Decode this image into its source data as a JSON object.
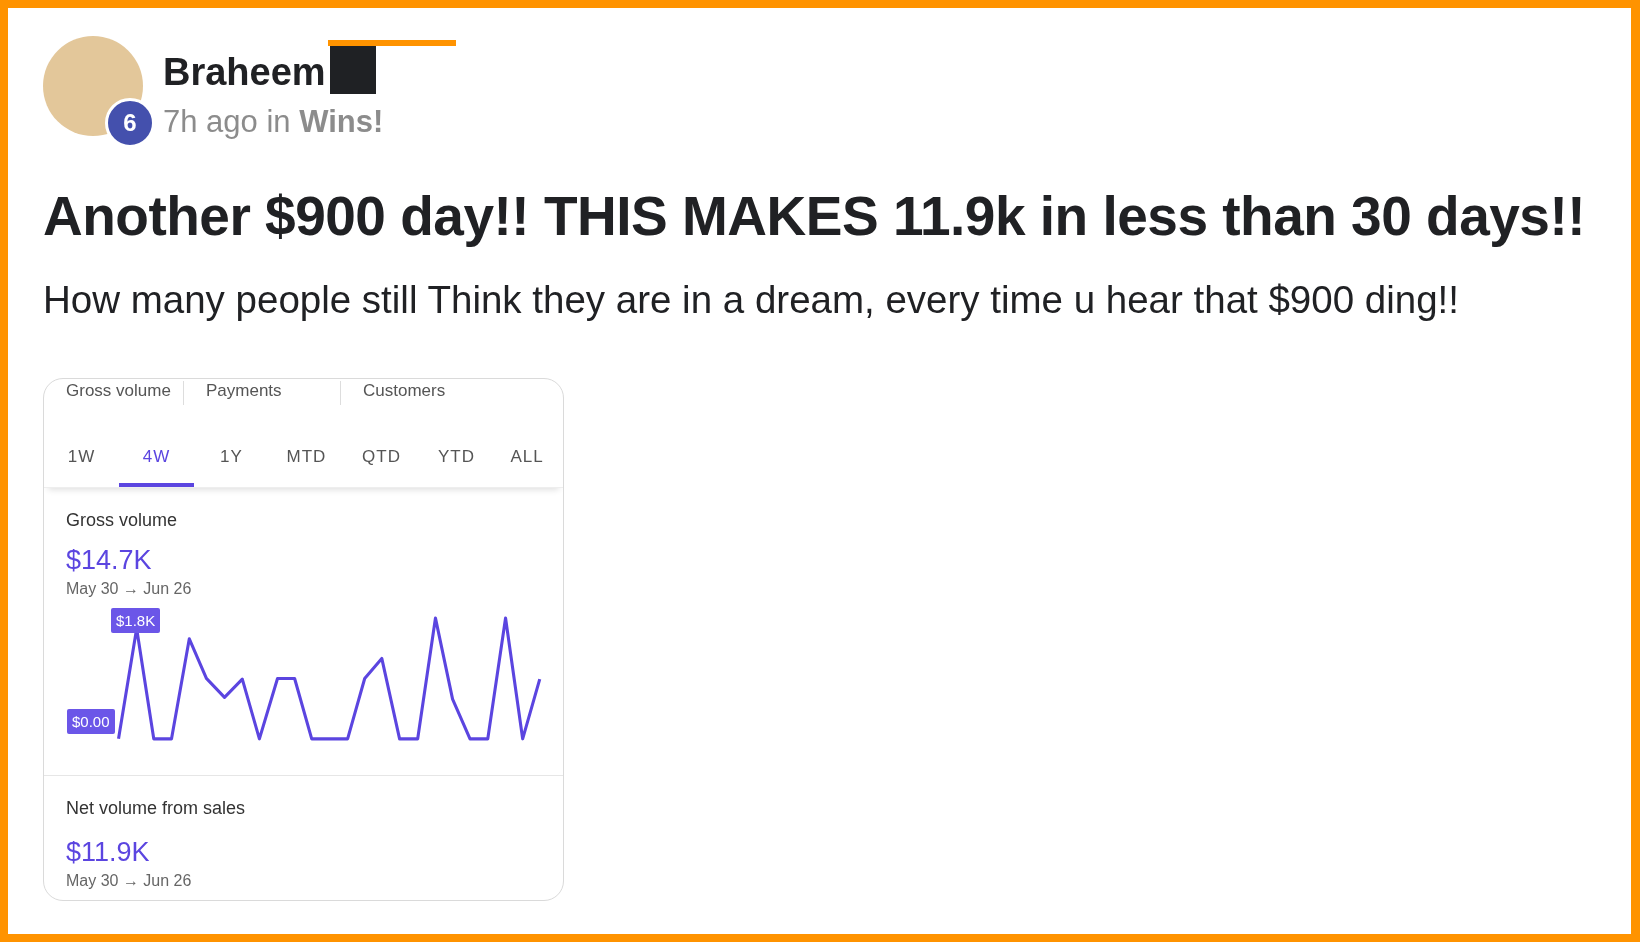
{
  "post": {
    "author": "Braheem",
    "level_badge": "6",
    "time": "7h ago in ",
    "category": "Wins!",
    "title": "Another $900 day!! THIS MAKES 11.9k in less than 30 days!!",
    "body": "How many people still Think they are in a dream, every time u hear that $900 ding!!"
  },
  "dashboard": {
    "top_tabs": [
      "Gross volume",
      "Payments",
      "Customers"
    ],
    "period_tabs": [
      {
        "label": "1W",
        "selected": false
      },
      {
        "label": "4W",
        "selected": true
      },
      {
        "label": "1Y",
        "selected": false
      },
      {
        "label": "MTD",
        "selected": false
      },
      {
        "label": "QTD",
        "selected": false
      },
      {
        "label": "YTD",
        "selected": false
      },
      {
        "label": "ALL",
        "selected": false
      }
    ],
    "metrics": [
      {
        "kind": "chart",
        "title": "Gross volume",
        "value": "$14.7K",
        "range": "May 30 → Jun 26",
        "max_label": "$1.8K",
        "min_label": "$0.00"
      },
      {
        "kind": "plain",
        "title": "Net volume from sales",
        "value": "$11.9K",
        "range": "May 30 → Jun 26"
      }
    ]
  }
}
